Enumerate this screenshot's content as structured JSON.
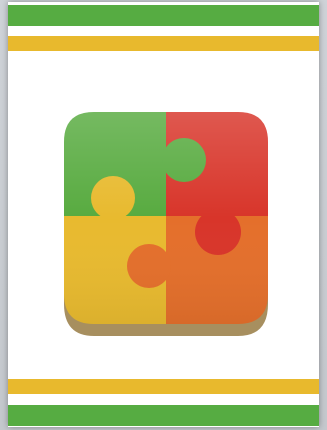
{
  "card": {
    "stripes": {
      "outer_color": "#56ac42",
      "inner_color": "#e8b92d"
    },
    "logo": {
      "icon": "puzzle-four-pieces-icon",
      "colors": {
        "green": "#58ab40",
        "red": "#d8352a",
        "yellow": "#e8ba2f",
        "orange": "#e46f2b"
      }
    }
  }
}
